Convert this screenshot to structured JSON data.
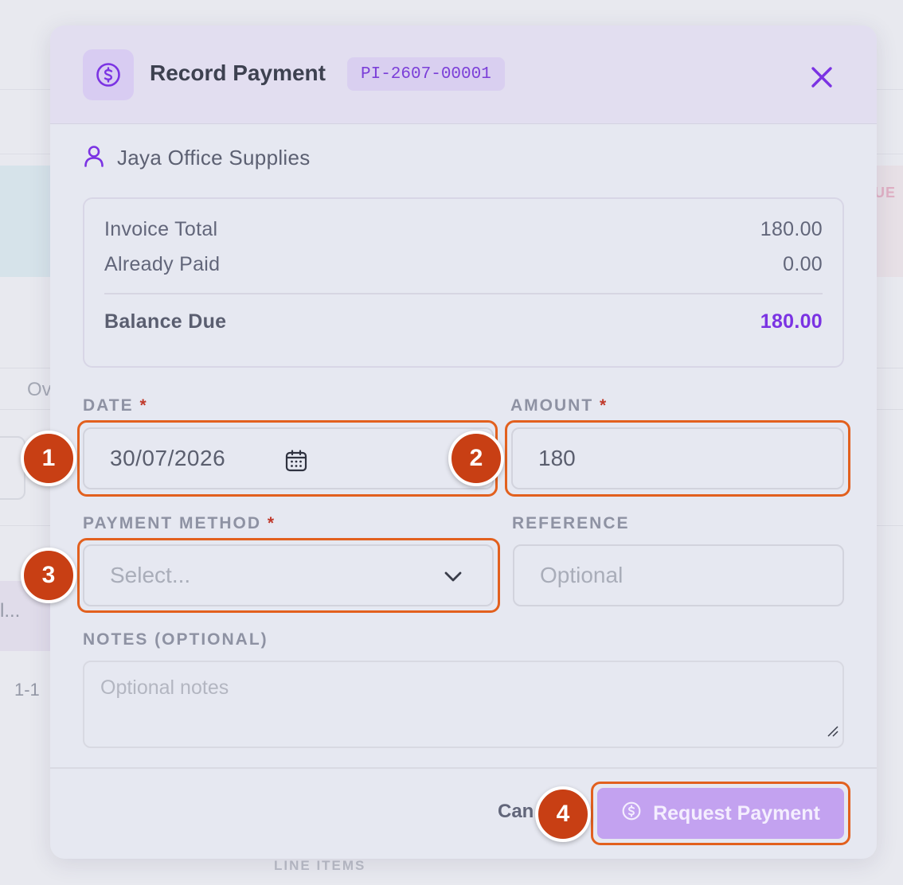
{
  "background": {
    "due_label": "UE",
    "tab_fragment": "Ov",
    "row_fragment": "l...",
    "pagination_fragment": "1-1",
    "section_label": "LINE ITEMS"
  },
  "modal": {
    "title": "Record Payment",
    "reference_badge": "PI-2607-00001",
    "header_icon": "dollar-circle-icon",
    "close_icon": "close-icon",
    "customer_icon": "user-icon",
    "customer_name": "Jaya Office Supplies",
    "summary": {
      "invoice_total_label": "Invoice Total",
      "invoice_total_value": "180.00",
      "already_paid_label": "Already Paid",
      "already_paid_value": "0.00",
      "balance_due_label": "Balance Due",
      "balance_due_value": "180.00"
    },
    "fields": {
      "date_label": "DATE",
      "date_value": "30/07/2026",
      "amount_label": "AMOUNT",
      "amount_value": "180",
      "payment_method_label": "PAYMENT METHOD",
      "payment_method_placeholder": "Select...",
      "reference_label": "REFERENCE",
      "reference_placeholder": "Optional",
      "notes_label": "NOTES (OPTIONAL)",
      "notes_placeholder": "Optional notes",
      "required_marker": "*"
    },
    "footer": {
      "cancel_label": "Can",
      "primary_label": "Request Payment",
      "primary_icon": "dollar-circle-icon"
    }
  },
  "annotations": {
    "markers": [
      "1",
      "2",
      "3",
      "4"
    ]
  },
  "colors": {
    "accent": "#7b33e3",
    "badge_text": "#7b3fd8",
    "primary_button": "#c3a2f0",
    "highlight": "#e2601e",
    "marker_fill": "#c83f14",
    "required": "#c0392b"
  }
}
